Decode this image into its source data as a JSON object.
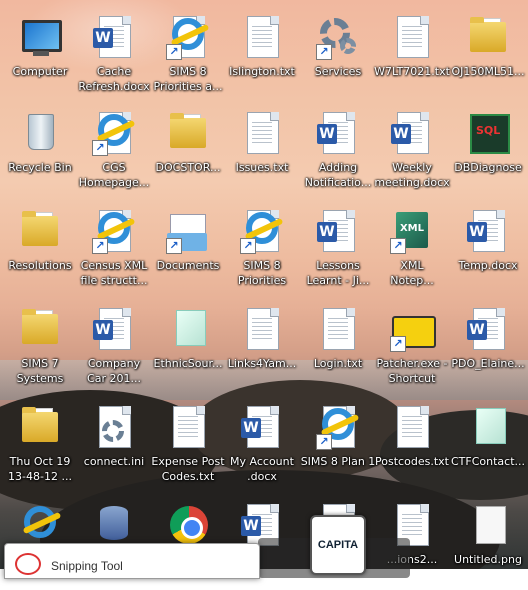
{
  "desktop": {
    "row1": [
      {
        "label": "Computer",
        "icon": "computer-icon"
      },
      {
        "label": "Cache\nRefresh.docx",
        "icon": "word-doc-icon"
      },
      {
        "label": "SIMS 8\nPriorities a...",
        "icon": "ie-shortcut-icon"
      },
      {
        "label": "Islington.txt",
        "icon": "text-file-icon"
      },
      {
        "label": "Services",
        "icon": "services-gear-icon"
      },
      {
        "label": "W7LT7021.txt",
        "icon": "text-file-icon"
      },
      {
        "label": "OJ150ML51...",
        "icon": "folder-icon"
      }
    ],
    "row2": [
      {
        "label": "Recycle Bin",
        "icon": "recycle-bin-icon"
      },
      {
        "label": "CGS\nHomepage...",
        "icon": "ie-shortcut-icon"
      },
      {
        "label": "DOCSTOR...",
        "icon": "folder-icon"
      },
      {
        "label": "Issues.txt",
        "icon": "text-file-icon"
      },
      {
        "label": "Adding\nNotificatio...",
        "icon": "word-doc-icon"
      },
      {
        "label": "Weekly\nmeeting.docx",
        "icon": "word-doc-icon"
      },
      {
        "label": "DBDiagnose",
        "icon": "dbdiagnose-icon"
      }
    ],
    "row3": [
      {
        "label": "Resolutions",
        "icon": "folder-icon"
      },
      {
        "label": "Census XML\nfile structt...",
        "icon": "ie-shortcut-icon"
      },
      {
        "label": "Documents",
        "icon": "documents-icon"
      },
      {
        "label": "SIMS 8\nPriorities",
        "icon": "ie-shortcut-icon"
      },
      {
        "label": "Lessons\nLearnt - Ji...",
        "icon": "word-doc-icon"
      },
      {
        "label": "XML\nNotep...",
        "icon": "xml-notepad-icon"
      },
      {
        "label": "Temp.docx",
        "icon": "word-doc-icon"
      }
    ],
    "row4": [
      {
        "label": "SIMS 7\nSystems",
        "icon": "folder-icon"
      },
      {
        "label": "Company\nCar 201...",
        "icon": "word-doc-icon"
      },
      {
        "label": "EthnicSour...",
        "icon": "ethnic-file-icon"
      },
      {
        "label": "Links4Yam...",
        "icon": "text-file-icon"
      },
      {
        "label": "Login.txt",
        "icon": "text-file-icon"
      },
      {
        "label": "Patcher.exe -\nShortcut",
        "icon": "patcher-shortcut-icon"
      },
      {
        "label": "PDO_Elaine...",
        "icon": "word-doc-icon"
      }
    ],
    "row5": [
      {
        "label": "Thu Oct 19\n13-48-12 ...",
        "icon": "folder-icon"
      },
      {
        "label": "connect.ini",
        "icon": "ini-settings-icon"
      },
      {
        "label": "Expense Post\nCodes.txt",
        "icon": "text-file-icon"
      },
      {
        "label": "My Account\n.docx",
        "icon": "word-doc-icon"
      },
      {
        "label": "SIMS 8 Plan 1",
        "icon": "ie-shortcut-icon"
      },
      {
        "label": "Postcodes.txt",
        "icon": "text-file-icon"
      },
      {
        "label": "CTFContact...",
        "icon": "ctf-file-icon"
      }
    ],
    "row6": [
      {
        "label": "",
        "icon": "ie-icon"
      },
      {
        "label": "",
        "icon": "database-icon"
      },
      {
        "label": "",
        "icon": "chrome-icon"
      },
      {
        "label": "",
        "icon": "word-doc-icon"
      },
      {
        "label": "",
        "icon": "capita-icon"
      },
      {
        "label": "...ions2...",
        "icon": "image-file-icon"
      },
      {
        "label": "Untitled.png",
        "icon": "png-file-icon"
      }
    ]
  },
  "taskbar_popup": {
    "snipping_label": "Snipping Tool",
    "capita_label": "CAPITA"
  }
}
